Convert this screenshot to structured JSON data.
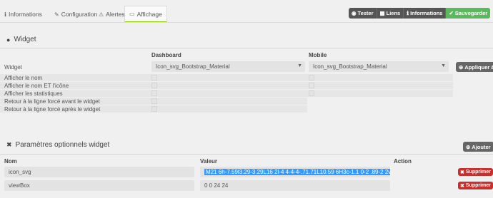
{
  "tabs": [
    {
      "icon": "ℹ",
      "label": "Informations"
    },
    {
      "icon": "✎",
      "label": "Configuration"
    },
    {
      "icon": "⚠",
      "label": "Alertes"
    },
    {
      "icon": "▭",
      "label": "Affichage"
    }
  ],
  "actions": {
    "tester": "Tester",
    "liens": "Liens",
    "informations": "Informations",
    "sauvegarder": "Sauvegarder"
  },
  "widget_section": {
    "title": "Widget",
    "dashboard_header": "Dashboard",
    "mobile_header": "Mobile",
    "widget_label": "Widget",
    "dashboard_value": "Icon_svg_Bootstrap_Material",
    "mobile_value": "Icon_svg_Bootstrap_Material",
    "apply_label": "Appliquer à",
    "rows": [
      "Afficher le nom",
      "Afficher le nom ET l'icône",
      "Afficher les statistiques",
      "Retour à la ligne forcé avant le widget",
      "Retour à la ligne forcé après le widget"
    ]
  },
  "params_section": {
    "title": "Paramètres optionnels widget",
    "add_label": "Ajouter",
    "col_name": "Nom",
    "col_value": "Valeur",
    "col_action": "Action",
    "delete_label": "Supprimer",
    "params": [
      {
        "name": "icon_svg",
        "value": "M21 6h-7.59l3.29-3.29L16 2l-4 4-4-4-.71.71L10.59 6H3c-1.1 0-2 .89-2 2v12c0"
      },
      {
        "name": "viewBox",
        "value": "0 0 24 24"
      }
    ]
  }
}
